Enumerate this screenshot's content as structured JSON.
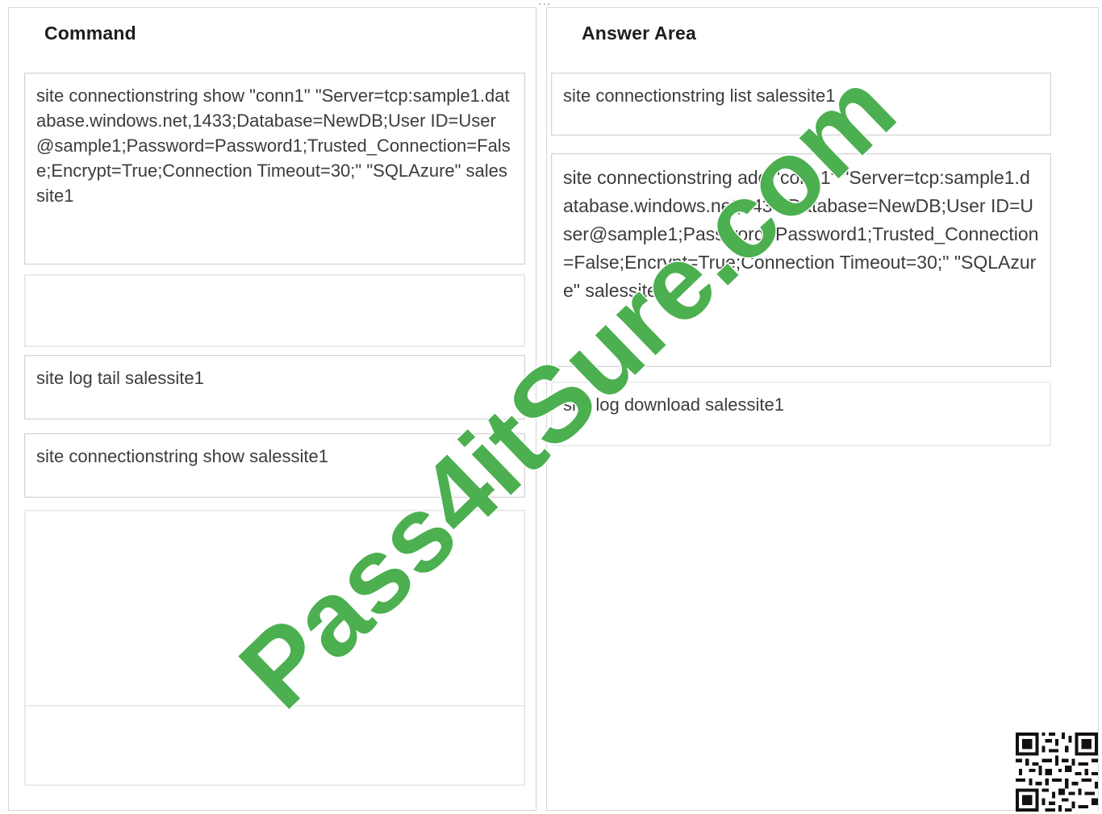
{
  "command_panel": {
    "title": "Command",
    "items": [
      {
        "text": "site connectionstring show \"conn1\" \"Server=tcp:sample1.database.windows.net,1433;Database=NewDB;User ID=User@sample1;Password=Password1;Trusted_Connection=False;Encrypt=True;Connection Timeout=30;\" \"SQLAzure\" salessite1"
      },
      {
        "text": ""
      },
      {
        "text": "site log tail salessite1"
      },
      {
        "text": "site connectionstring show salessite1"
      },
      {
        "text": ""
      },
      {
        "text": ""
      }
    ]
  },
  "answer_panel": {
    "title": "Answer Area",
    "items": [
      {
        "text": "site connectionstring list salessite1"
      },
      {
        "text": "site connectionstring add \"conn1\" \"Server=tcp:sample1.database.windows.net,1433;Database=NewDB;User ID=User@sample1;Password=Password1;Trusted_Connection=False;Encrypt=True;Connection Timeout=30;\" \"SQLAzure\" salessite1"
      },
      {
        "text": "site log download salessite1"
      }
    ]
  },
  "watermark": {
    "text": "Pass4itSure.com",
    "color": "#4caf50"
  },
  "qr_code": {
    "icon": "qr-code-icon"
  },
  "top_divider": {
    "text": "..."
  }
}
